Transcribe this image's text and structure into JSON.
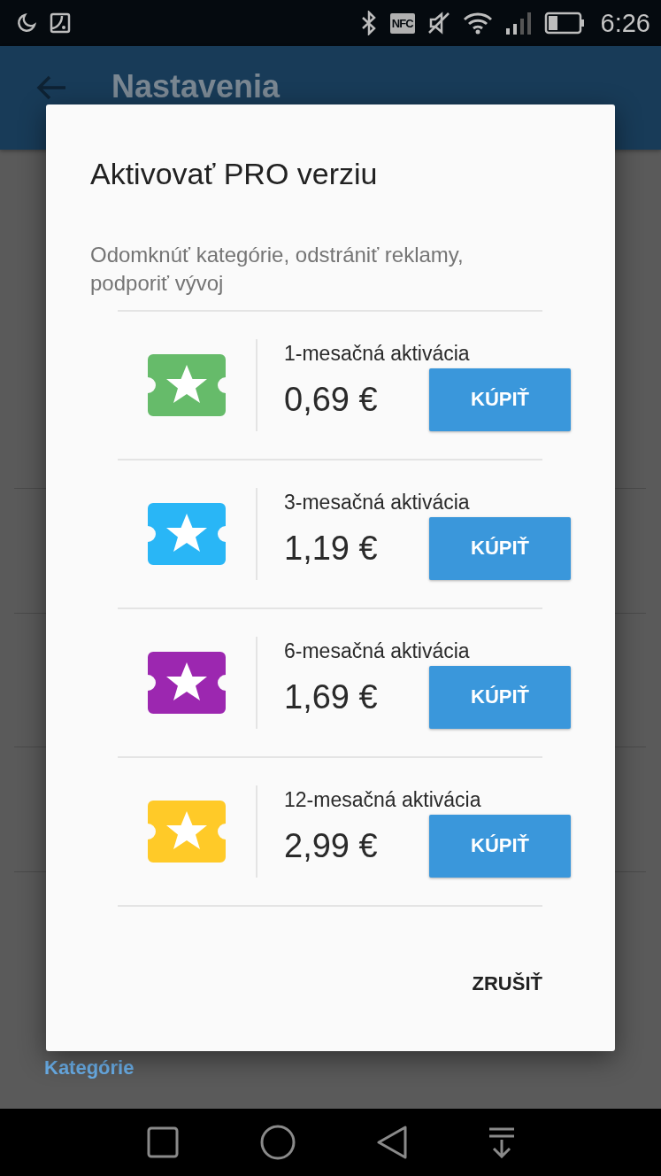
{
  "status_bar": {
    "nfc": "NFC",
    "time": "6:26"
  },
  "app_bar": {
    "title": "Nastavenia"
  },
  "background": {
    "section": "Kategórie"
  },
  "dialog": {
    "title": "Aktivovať PRO verziu",
    "subtitle": "Odomknúť kategórie, odstrániť reklamy, podporiť vývoj",
    "plans": [
      {
        "name": "1-mesačná aktivácia",
        "price": "0,69 €",
        "button": "KÚPIŤ",
        "color": "#66bb6a"
      },
      {
        "name": "3-mesačná aktivácia",
        "price": "1,19 €",
        "button": "KÚPIŤ",
        "color": "#29b6f6"
      },
      {
        "name": "6-mesačná aktivácia",
        "price": "1,69 €",
        "button": "KÚPIŤ",
        "color": "#9c27b0"
      },
      {
        "name": "12-mesačná aktivácia",
        "price": "2,99 €",
        "button": "KÚPIŤ",
        "color": "#ffca28"
      }
    ],
    "cancel": "ZRUŠIŤ"
  }
}
